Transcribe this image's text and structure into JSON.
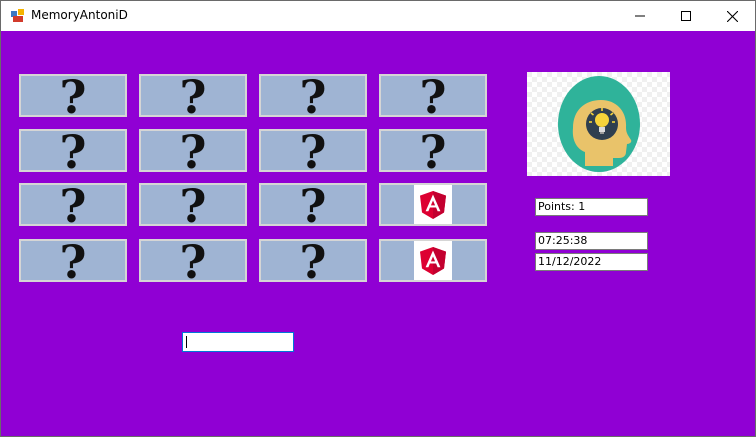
{
  "window": {
    "title": "MemoryAntoniD",
    "controls": [
      "minimize-icon",
      "maximize-icon",
      "close-icon"
    ]
  },
  "board": {
    "rows": [
      [
        "?",
        "?",
        "?",
        "?"
      ],
      [
        "?",
        "?",
        "?",
        "?"
      ],
      [
        "?",
        "?",
        "?",
        "angular"
      ],
      [
        "?",
        "?",
        "?",
        "angular"
      ]
    ],
    "hidden_card_symbol": "?",
    "revealed_card_icon": "angular-logo-icon",
    "card_color": "#9fb4d3"
  },
  "side_panel": {
    "logo_icon": "head-lightbulb-icon",
    "points": "Points: 1",
    "time": "07:25:38",
    "date": "11/12/2022"
  },
  "input": {
    "value": ""
  },
  "colors": {
    "background": "#9000d4",
    "angular_red": "#dd0031"
  }
}
